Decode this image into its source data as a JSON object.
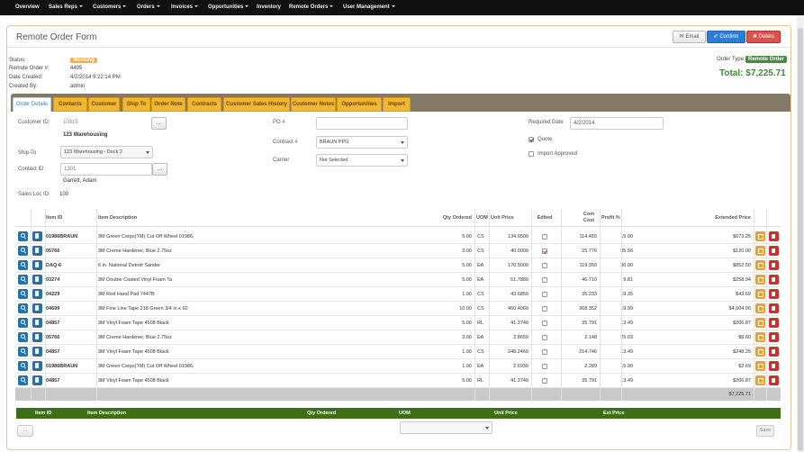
{
  "nav": {
    "items": [
      {
        "label": "Overview",
        "caret": false
      },
      {
        "label": "Sales Reps",
        "caret": true
      },
      {
        "label": "Customers",
        "caret": true
      },
      {
        "label": "Orders",
        "caret": true
      },
      {
        "label": "Invoices",
        "caret": true
      },
      {
        "label": "Opportunities",
        "caret": true
      },
      {
        "label": "Inventory",
        "caret": false
      },
      {
        "label": "Remote Orders",
        "caret": true
      },
      {
        "label": "User Management",
        "caret": true
      }
    ]
  },
  "header": {
    "title": "Remote Order Form",
    "email_label": "Email",
    "confirm_label": "Confirm",
    "delete_label": "Delete"
  },
  "info": {
    "status_label": "Status:",
    "status_value": "Working",
    "remote_order_label": "Remote Order #:",
    "remote_order_value": "4495",
    "date_created_label": "Date Created:",
    "date_created_value": "4/2/2014 9:22:14 PM",
    "created_by_label": "Created By:",
    "created_by_value": "admin",
    "order_type_label": "Order Type:",
    "order_type_value": "Remote Order",
    "total_text": "Total:  $7,225.71"
  },
  "tabs": [
    "Order Details",
    "Contacts",
    "Customer",
    "Ship To",
    "Order Note",
    "Contracts",
    "Customer Sales History",
    "Customer Notes",
    "Opportunities",
    "Import"
  ],
  "form": {
    "customer_id_label": "Customer ID:",
    "customer_id_value": "10315",
    "customer_name": "123 Warehousing",
    "ship_to_label": "Ship-To",
    "ship_to_value": "123 Warehousing - Dock 2",
    "contact_id_label": "Contact ID:",
    "contact_id_value": "1301",
    "contact_name": "Garrett, Adam",
    "sales_loc_label": "Sales Loc ID:",
    "sales_loc_value": "100",
    "ellipsis": "...",
    "po_label": "PO #",
    "po_value": "",
    "contract_label": "Contract #",
    "contract_value": "BRAUN PPG",
    "carrier_label": "Carrier",
    "carrier_value": "Not Selected",
    "required_date_label": "Required Date",
    "required_date_value": "4/2/2014",
    "quote_label": "Quote",
    "quote_checked": true,
    "import_approved_label": "Import Approved",
    "import_approved_checked": false
  },
  "grid": {
    "headers": {
      "item_id": "Item ID",
      "item_description": "Item Description",
      "qty_ordered": "Qty Ordered",
      "uom": "UOM",
      "unit_price": "Unit Price",
      "edited": "Edited",
      "com_cost": "Com Cost",
      "profit": "Profit %",
      "extended_price": "Extended Price"
    },
    "rows": [
      {
        "item_id": "01986BRAUN",
        "desc": "3M Green Corps(TM) Cut Off Wheel 01986,",
        "qty": "5.00",
        "uom": "CS",
        "unit_price": "134.6500",
        "edited": false,
        "com_cost": "114.450",
        "profit": "15.00",
        "ext": "$673.25"
      },
      {
        "item_id": "05766",
        "desc": "3M Creme Hardener, Blue 2.75oz",
        "qty": "3.00",
        "uom": "CS",
        "unit_price": "40.0000",
        "edited": true,
        "com_cost": "25.776",
        "profit": "35.56",
        "ext": "$120.00"
      },
      {
        "item_id": "DAQ-6",
        "desc": "6 in. National Detroit Sander",
        "qty": "5.00",
        "uom": "EA",
        "unit_price": "170.5000",
        "edited": false,
        "com_cost": "119.350",
        "profit": "30.00",
        "ext": "$852.50"
      },
      {
        "item_id": "03274",
        "desc": "3M Double Coated Vinyl Foam Ta",
        "qty": "5.00",
        "uom": "EA",
        "unit_price": "51.7880",
        "edited": false,
        "com_cost": "46.710",
        "profit": "9.81",
        "ext": "$258.94"
      },
      {
        "item_id": "04229",
        "desc": "3M Red Hand Pad 7447B",
        "qty": "1.00",
        "uom": "CS",
        "unit_price": "43.6850",
        "edited": false,
        "com_cost": "35.233",
        "profit": "19.35",
        "ext": "$43.69"
      },
      {
        "item_id": "04699",
        "desc": "3M Fine Line Tape 218 Green 3/4 in x 60",
        "qty": "10.00",
        "uom": "CS",
        "unit_price": "460.4060",
        "edited": false,
        "com_cost": "368.352",
        "profit": "19.99",
        "ext": "$4,604.06"
      },
      {
        "item_id": "04857",
        "desc": "3M Vinyl Foam Tape 4508 Black",
        "qty": "5.00",
        "uom": "RL",
        "unit_price": "41.3740",
        "edited": false,
        "com_cost": "35.791",
        "profit": "13.49",
        "ext": "$206.87"
      },
      {
        "item_id": "05766",
        "desc": "3M Creme Hardener, Blue 2.75oz",
        "qty": "3.00",
        "uom": "EA",
        "unit_price": "2.8650",
        "edited": false,
        "com_cost": "2.148",
        "profit": "25.03",
        "ext": "$8.60"
      },
      {
        "item_id": "04857",
        "desc": "3M Vinyl Foam Tape 4508 Black",
        "qty": "1.00",
        "uom": "CS",
        "unit_price": "248.2460",
        "edited": false,
        "com_cost": "214.746",
        "profit": "13.49",
        "ext": "$248.25"
      },
      {
        "item_id": "01986BRAUN",
        "desc": "3M Green Corps(TM) Cut Off Wheel 01986,",
        "qty": "1.00",
        "uom": "EA",
        "unit_price": "2.6930",
        "edited": false,
        "com_cost": "2.289",
        "profit": "15.00",
        "ext": "$2.69"
      },
      {
        "item_id": "04857",
        "desc": "3M Vinyl Foam Tape 4508 Black",
        "qty": "5.00",
        "uom": "RL",
        "unit_price": "41.3740",
        "edited": false,
        "com_cost": "35.791",
        "profit": "13.49",
        "ext": "$206.87"
      }
    ],
    "total": "$7,225.71"
  },
  "add_row": {
    "item_id": "Item ID",
    "item_description": "Item Description",
    "qty_ordered": "Qty Ordered",
    "uom": "UOM",
    "unit_price": "Unit Price",
    "ext_price": "Ext Price",
    "small_button": "...",
    "save_label": "Save"
  },
  "colors": {
    "accent": "#2a7fd4",
    "tab": "#f0b830",
    "tabbar": "#847966",
    "success": "#3c8a35",
    "danger": "#d9534f",
    "add_bar": "#3e6f14"
  }
}
